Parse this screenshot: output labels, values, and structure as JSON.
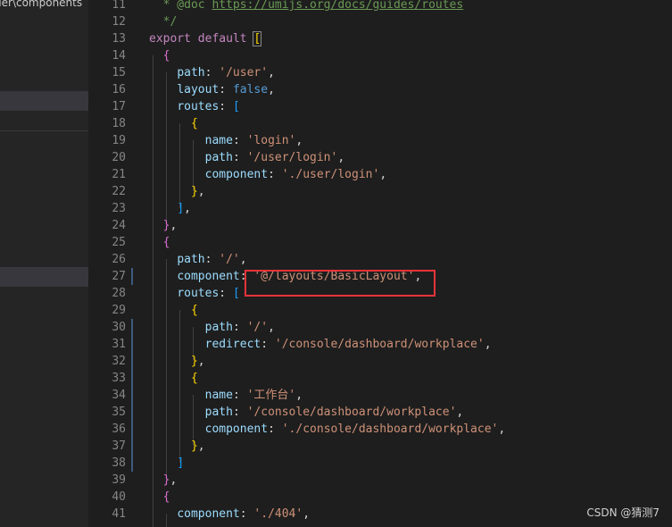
{
  "sidebar": {
    "path_text": "der\\components"
  },
  "editor": {
    "lines": [
      {
        "n": "11",
        "indent": "  ",
        "tokens": [
          {
            "t": "* @doc ",
            "c": "#6a9955"
          },
          {
            "t": "https://umijs.org/docs/guides/routes",
            "c": "#6a9955",
            "u": true
          }
        ]
      },
      {
        "n": "12",
        "indent": "  ",
        "tokens": [
          {
            "t": "*/",
            "c": "#6a9955"
          }
        ]
      },
      {
        "n": "13",
        "indent": "",
        "tokens": [
          {
            "t": "export",
            "c": "#c586c0"
          },
          {
            "t": " ",
            "c": "#d4d4d4"
          },
          {
            "t": "default",
            "c": "#c586c0"
          },
          {
            "t": " ",
            "c": "#d4d4d4"
          },
          {
            "t": "[",
            "c": "#ffd700",
            "box": true
          }
        ]
      },
      {
        "n": "14",
        "indent": "  ",
        "tokens": [
          {
            "t": "{",
            "c": "#da70d6"
          }
        ]
      },
      {
        "n": "15",
        "indent": "    ",
        "tokens": [
          {
            "t": "path",
            "c": "#9cdcfe"
          },
          {
            "t": ": ",
            "c": "#d4d4d4"
          },
          {
            "t": "'/user'",
            "c": "#ce9178"
          },
          {
            "t": ",",
            "c": "#d4d4d4"
          }
        ]
      },
      {
        "n": "16",
        "indent": "    ",
        "tokens": [
          {
            "t": "layout",
            "c": "#9cdcfe"
          },
          {
            "t": ": ",
            "c": "#d4d4d4"
          },
          {
            "t": "false",
            "c": "#569cd6"
          },
          {
            "t": ",",
            "c": "#d4d4d4"
          }
        ]
      },
      {
        "n": "17",
        "indent": "    ",
        "tokens": [
          {
            "t": "routes",
            "c": "#9cdcfe"
          },
          {
            "t": ": ",
            "c": "#d4d4d4"
          },
          {
            "t": "[",
            "c": "#179fff"
          }
        ]
      },
      {
        "n": "18",
        "indent": "      ",
        "tokens": [
          {
            "t": "{",
            "c": "#ffd700"
          }
        ]
      },
      {
        "n": "19",
        "indent": "        ",
        "tokens": [
          {
            "t": "name",
            "c": "#9cdcfe"
          },
          {
            "t": ": ",
            "c": "#d4d4d4"
          },
          {
            "t": "'login'",
            "c": "#ce9178"
          },
          {
            "t": ",",
            "c": "#d4d4d4"
          }
        ]
      },
      {
        "n": "20",
        "indent": "        ",
        "tokens": [
          {
            "t": "path",
            "c": "#9cdcfe"
          },
          {
            "t": ": ",
            "c": "#d4d4d4"
          },
          {
            "t": "'/user/login'",
            "c": "#ce9178"
          },
          {
            "t": ",",
            "c": "#d4d4d4"
          }
        ]
      },
      {
        "n": "21",
        "indent": "        ",
        "tokens": [
          {
            "t": "component",
            "c": "#9cdcfe"
          },
          {
            "t": ": ",
            "c": "#d4d4d4"
          },
          {
            "t": "'./user/login'",
            "c": "#ce9178"
          },
          {
            "t": ",",
            "c": "#d4d4d4"
          }
        ]
      },
      {
        "n": "22",
        "indent": "      ",
        "tokens": [
          {
            "t": "}",
            "c": "#ffd700"
          },
          {
            "t": ",",
            "c": "#d4d4d4"
          }
        ]
      },
      {
        "n": "23",
        "indent": "    ",
        "tokens": [
          {
            "t": "]",
            "c": "#179fff"
          },
          {
            "t": ",",
            "c": "#d4d4d4"
          }
        ]
      },
      {
        "n": "24",
        "indent": "  ",
        "tokens": [
          {
            "t": "}",
            "c": "#da70d6"
          },
          {
            "t": ",",
            "c": "#d4d4d4"
          }
        ]
      },
      {
        "n": "25",
        "indent": "  ",
        "tokens": [
          {
            "t": "{",
            "c": "#da70d6"
          }
        ]
      },
      {
        "n": "26",
        "indent": "    ",
        "tokens": [
          {
            "t": "path",
            "c": "#9cdcfe"
          },
          {
            "t": ": ",
            "c": "#d4d4d4"
          },
          {
            "t": "'/'",
            "c": "#ce9178"
          },
          {
            "t": ",",
            "c": "#d4d4d4"
          }
        ]
      },
      {
        "n": "27",
        "indent": "    ",
        "mark": true,
        "tokens": [
          {
            "t": "component",
            "c": "#9cdcfe"
          },
          {
            "t": ": ",
            "c": "#d4d4d4"
          },
          {
            "t": "'@/layouts/BasicLayout'",
            "c": "#ce9178"
          },
          {
            "t": ",",
            "c": "#d4d4d4"
          }
        ]
      },
      {
        "n": "28",
        "indent": "    ",
        "tokens": [
          {
            "t": "routes",
            "c": "#9cdcfe"
          },
          {
            "t": ": ",
            "c": "#d4d4d4"
          },
          {
            "t": "[",
            "c": "#179fff"
          }
        ]
      },
      {
        "n": "29",
        "indent": "      ",
        "tokens": [
          {
            "t": "{",
            "c": "#ffd700"
          }
        ]
      },
      {
        "n": "30",
        "indent": "        ",
        "mark": true,
        "tokens": [
          {
            "t": "path",
            "c": "#9cdcfe"
          },
          {
            "t": ": ",
            "c": "#d4d4d4"
          },
          {
            "t": "'/'",
            "c": "#ce9178"
          },
          {
            "t": ",",
            "c": "#d4d4d4"
          }
        ]
      },
      {
        "n": "31",
        "indent": "        ",
        "mark": true,
        "tokens": [
          {
            "t": "redirect",
            "c": "#9cdcfe"
          },
          {
            "t": ": ",
            "c": "#d4d4d4"
          },
          {
            "t": "'/console/dashboard/workplace'",
            "c": "#ce9178"
          },
          {
            "t": ",",
            "c": "#d4d4d4"
          }
        ]
      },
      {
        "n": "32",
        "indent": "      ",
        "mark": true,
        "tokens": [
          {
            "t": "}",
            "c": "#ffd700"
          },
          {
            "t": ",",
            "c": "#d4d4d4"
          }
        ]
      },
      {
        "n": "33",
        "indent": "      ",
        "mark": true,
        "tokens": [
          {
            "t": "{",
            "c": "#ffd700"
          }
        ]
      },
      {
        "n": "34",
        "indent": "        ",
        "mark": true,
        "tokens": [
          {
            "t": "name",
            "c": "#9cdcfe"
          },
          {
            "t": ": ",
            "c": "#d4d4d4"
          },
          {
            "t": "'工作台'",
            "c": "#ce9178"
          },
          {
            "t": ",",
            "c": "#d4d4d4"
          }
        ]
      },
      {
        "n": "35",
        "indent": "        ",
        "mark": true,
        "tokens": [
          {
            "t": "path",
            "c": "#9cdcfe"
          },
          {
            "t": ": ",
            "c": "#d4d4d4"
          },
          {
            "t": "'/console/dashboard/workplace'",
            "c": "#ce9178"
          },
          {
            "t": ",",
            "c": "#d4d4d4"
          }
        ]
      },
      {
        "n": "36",
        "indent": "        ",
        "mark": true,
        "tokens": [
          {
            "t": "component",
            "c": "#9cdcfe"
          },
          {
            "t": ": ",
            "c": "#d4d4d4"
          },
          {
            "t": "'./console/dashboard/workplace'",
            "c": "#ce9178"
          },
          {
            "t": ",",
            "c": "#d4d4d4"
          }
        ]
      },
      {
        "n": "37",
        "indent": "      ",
        "mark": true,
        "tokens": [
          {
            "t": "}",
            "c": "#ffd700"
          },
          {
            "t": ",",
            "c": "#d4d4d4"
          }
        ]
      },
      {
        "n": "38",
        "indent": "    ",
        "mark": true,
        "tokens": [
          {
            "t": "]",
            "c": "#179fff"
          }
        ]
      },
      {
        "n": "39",
        "indent": "  ",
        "tokens": [
          {
            "t": "}",
            "c": "#da70d6"
          },
          {
            "t": ",",
            "c": "#d4d4d4"
          }
        ]
      },
      {
        "n": "40",
        "indent": "  ",
        "tokens": [
          {
            "t": "{",
            "c": "#da70d6"
          }
        ]
      },
      {
        "n": "41",
        "indent": "    ",
        "tokens": [
          {
            "t": "component",
            "c": "#9cdcfe"
          },
          {
            "t": ": ",
            "c": "#d4d4d4"
          },
          {
            "t": "'./404'",
            "c": "#ce9178"
          },
          {
            "t": ",",
            "c": "#d4d4d4"
          }
        ]
      }
    ]
  },
  "watermark": {
    "text": "CSDN @猜测7"
  },
  "theme": {
    "background": "#1e1e1e",
    "sidebar": "#252526",
    "highlight_box": "#e8333a"
  }
}
